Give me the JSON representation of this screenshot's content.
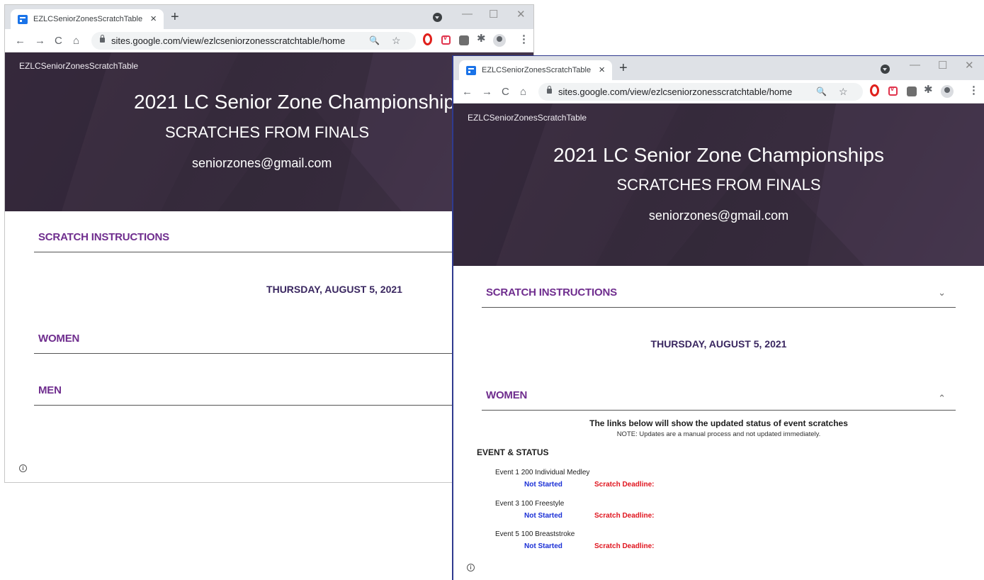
{
  "browser": {
    "tab_title": "EZLCSeniorZonesScratchTable",
    "tab_close": "×",
    "new_tab": "+",
    "url": "sites.google.com/view/ezlcseniorzonesscratchtable/home",
    "nav_back": "←",
    "nav_forward": "→",
    "nav_reload": "C",
    "nav_home": "⌂",
    "zoom_icon": "🔍",
    "bookmark_icon": "☆",
    "puzzle_icon": "✱",
    "menu_icon": "⋮",
    "minimize": "—",
    "maximize": "☐",
    "close": "✕"
  },
  "site": {
    "name": "EZLCSeniorZonesScratchTable",
    "title": "2021 LC Senior Zone Championships",
    "subtitle": "SCRATCHES FROM FINALS",
    "email": "seniorzones@gmail.com",
    "info_icon": "i"
  },
  "sections": {
    "instructions": "SCRATCH INSTRUCTIONS",
    "date": "THURSDAY, AUGUST 5, 2021",
    "women": "WOMEN",
    "men": "MEN",
    "chevron_down": "⌄",
    "chevron_up": "⌃"
  },
  "women_panel": {
    "heading": "The links below will show the updated status of event scratches",
    "note": "NOTE:  Updates are a manual process and not updated immediately.",
    "list_header": "EVENT & STATUS",
    "events": [
      {
        "name": "Event 1   200 Individual Medley",
        "status": "Not Started",
        "deadline": "Scratch Deadline:"
      },
      {
        "name": "Event 3   100 Freestyle",
        "status": "Not Started",
        "deadline": "Scratch Deadline:"
      },
      {
        "name": "Event 5   100 Breaststroke",
        "status": "Not Started",
        "deadline": "Scratch Deadline:"
      }
    ]
  },
  "colors": {
    "section_title": "#6f2d8e",
    "date": "#3a2760",
    "status_blue": "#1a2fd6",
    "deadline_red": "#e0141e",
    "hero_bg": "#3a2d40"
  }
}
